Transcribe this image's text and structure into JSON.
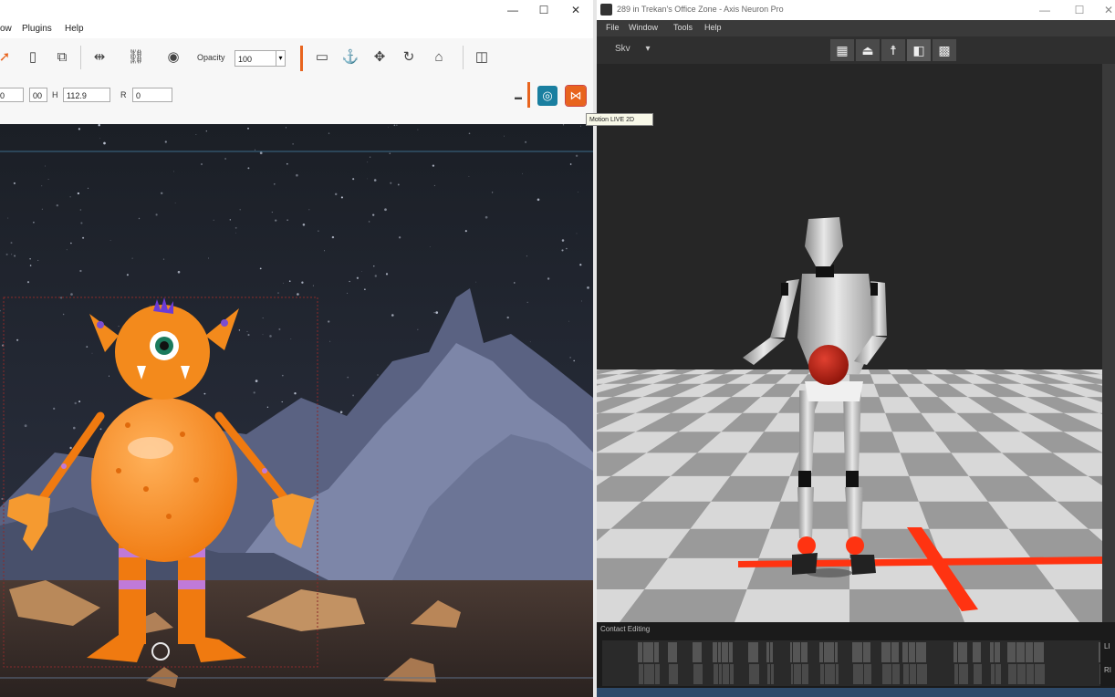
{
  "left_window": {
    "menu": [
      "ow",
      "Plugins",
      "Help"
    ],
    "controls": {
      "minimize": "—",
      "maximize": "☐",
      "close": "✕"
    },
    "toolbar": {
      "opacity_label": "Opacity",
      "opacity_value": "100",
      "opacity_dropdown": "▾"
    },
    "transform": {
      "field_a": "0",
      "field_b": "00",
      "h_label": "H",
      "h_value": "112.9",
      "r_label": "R",
      "r_value": "0"
    },
    "tooltip": "Motion LIVE 2D",
    "icon_names": [
      "pointer-icon",
      "page-icon",
      "layers-icon",
      "flip-icon",
      "link-icon",
      "eye-icon",
      "camera-icon",
      "anchor-icon",
      "move-icon",
      "rotate-icon",
      "home-icon",
      "panel-icon",
      "motion-live-blue-icon",
      "motion-live-orange-icon"
    ],
    "accent": "#e8641e"
  },
  "right_window": {
    "title": "289 in Trekan's Office Zone - Axis Neuron Pro",
    "controls": {
      "minimize": "—",
      "maximize": "☐",
      "close": "✕"
    },
    "menu": [
      "File",
      "Window",
      "Tools",
      "Help"
    ],
    "view_dropdown": "Skv",
    "bottom_panel_label": "Contact Editing",
    "side_labels": [
      "LI",
      "RI"
    ],
    "floor_marker_color": "#ff3311"
  }
}
